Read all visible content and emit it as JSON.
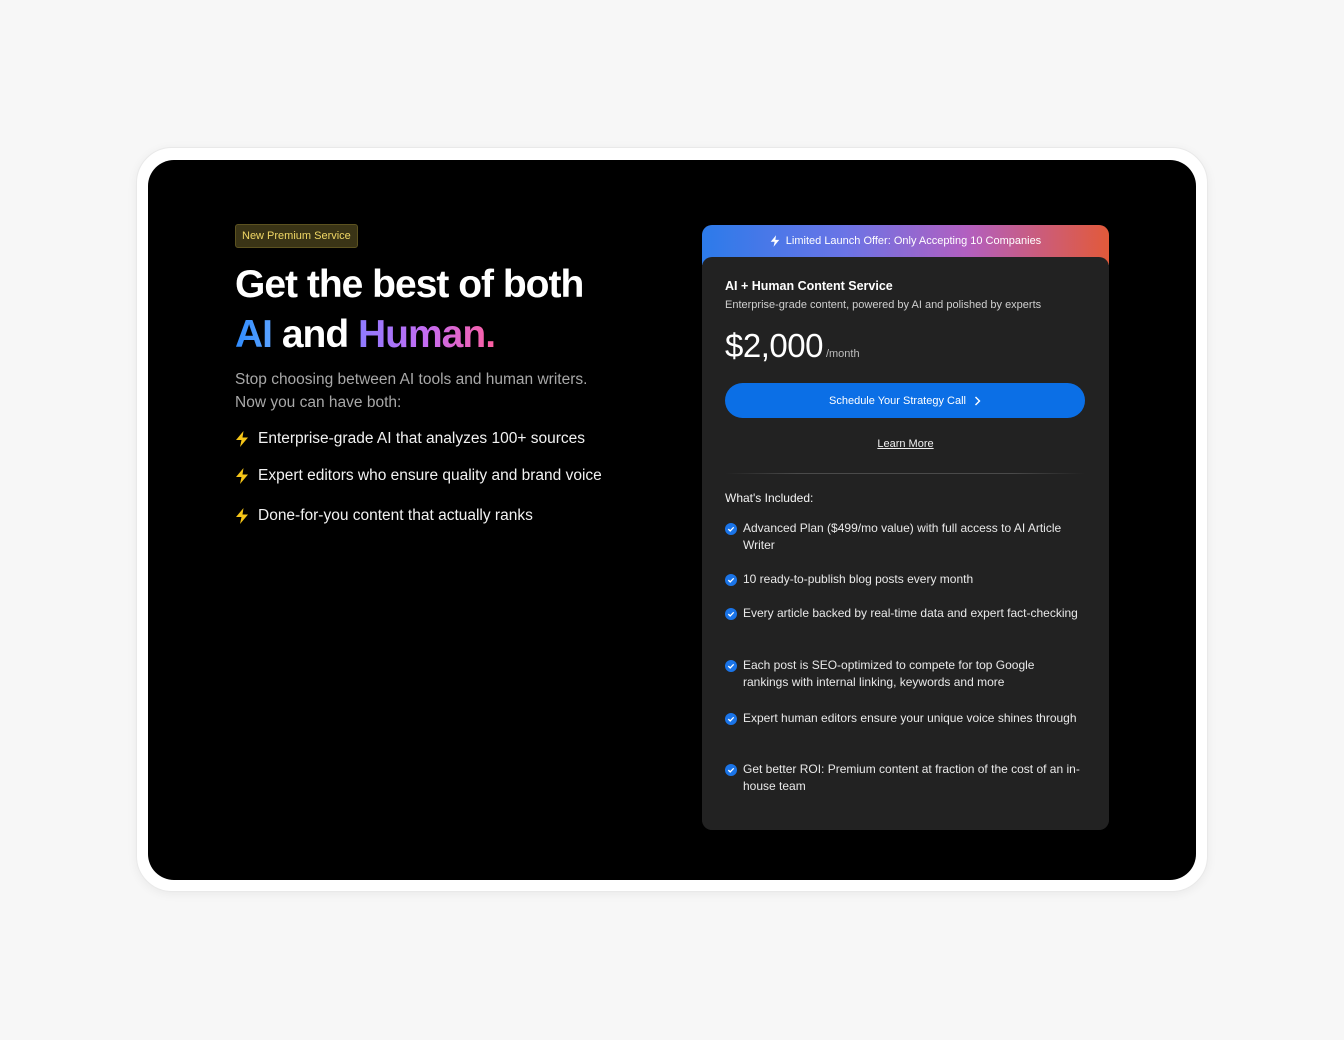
{
  "hero": {
    "badge": "New Premium Service",
    "headline_line1": "Get the best of both",
    "headline_ai": "AI",
    "headline_and": " and ",
    "headline_human": "Human.",
    "subtitle_line1": "Stop choosing between AI tools and human writers.",
    "subtitle_line2": "Now you can have both:",
    "features": [
      "Enterprise-grade AI that analyzes 100+ sources",
      "Expert editors who ensure quality and brand voice",
      "Done-for-you content that actually ranks"
    ]
  },
  "card": {
    "ribbon": "Limited Launch Offer: Only Accepting 10 Companies",
    "title": "AI + Human Content Service",
    "description": "Enterprise-grade content, powered by AI and polished by experts",
    "price": "$2,000",
    "price_period": "/month",
    "cta_label": "Schedule Your Strategy Call",
    "learn_more": "Learn More",
    "included_title": "What's Included:",
    "included_items": [
      "Advanced Plan ($499/mo value) with full access to AI Article Writer",
      "10 ready-to-publish blog posts every month",
      "Every article backed by real-time data and expert fact-checking",
      "Each post is SEO-optimized to compete for top Google rankings with internal linking, keywords and more",
      "Expert human editors ensure your unique voice shines through",
      "Get better ROI: Premium content at fraction of the cost of an in-house team"
    ]
  },
  "colors": {
    "accent_blue": "#0b6fe6",
    "bolt_yellow": "#f5c518",
    "badge_text": "#f0d765"
  },
  "icons": {
    "feature_icon": "lightning-bolt-icon",
    "ribbon_icon": "lightning-bolt-icon",
    "cta_icon": "chevron-right-icon",
    "included_icon": "check-circle-icon"
  }
}
